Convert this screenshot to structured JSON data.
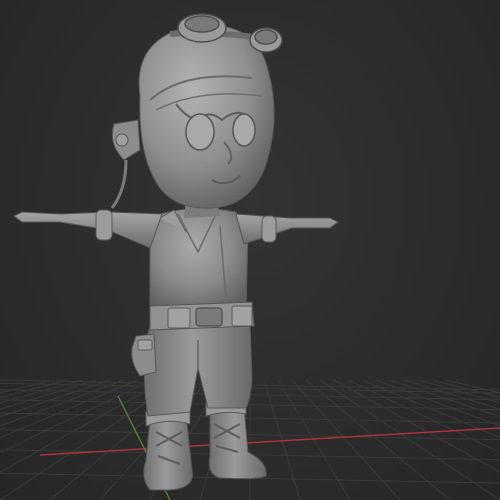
{
  "viewport": {
    "background_color": "#2b2b2b",
    "grid": {
      "visible": true,
      "line_color": "#3a3a3a",
      "x_axis_color": "#a8323e",
      "y_axis_color": "#5a8a2a"
    }
  },
  "model": {
    "shading": "solid-matcap-grey",
    "base_color": "#8a8a8a",
    "pose": "t-pose",
    "parts": [
      "aviator-cap",
      "goggles",
      "head",
      "ear-flap",
      "vest",
      "arms",
      "belt",
      "holster",
      "trousers",
      "boots"
    ]
  }
}
